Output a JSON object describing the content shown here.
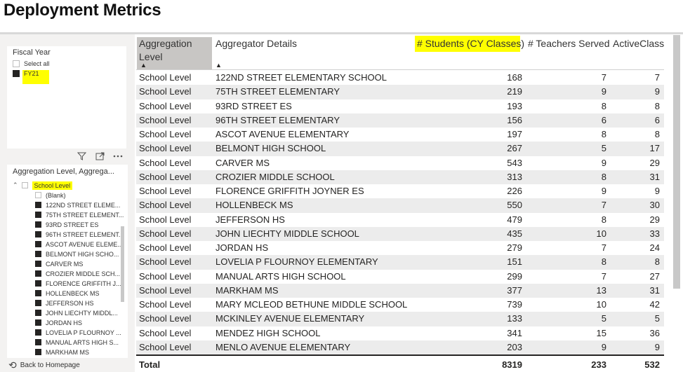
{
  "title": "Deployment Metrics",
  "fiscal_year_slicer": {
    "title": "Fiscal Year",
    "select_all_label": "Select all",
    "selected_year": "FY21"
  },
  "aggregation_slicer": {
    "title": "Aggregation Level, Aggrega...",
    "school_level_label": "School Level",
    "blank_label": "(Blank)",
    "items": [
      "122ND STREET ELEME...",
      "75TH STREET ELEMENT...",
      "93RD STREET ES",
      "96TH STREET ELEMENT...",
      "ASCOT AVENUE ELEME...",
      "BELMONT HIGH SCHO...",
      "CARVER MS",
      "CROZIER MIDDLE SCH...",
      "FLORENCE GRIFFITH J...",
      "HOLLENBECK MS",
      "JEFFERSON HS",
      "JOHN LIECHTY MIDDL...",
      "JORDAN HS",
      "LOVELIA P FLOURNOY ...",
      "MANUAL ARTS HIGH S...",
      "MARKHAM MS"
    ]
  },
  "back_link_label": "Back to Homepage",
  "table": {
    "headers": {
      "aggregation_level_line1": "Aggregation",
      "aggregation_level_line2": "Level",
      "aggregator_details": "Aggregator Details",
      "students": "# Students (CY Classes)",
      "teachers": "# Teachers Served",
      "active_class": "ActiveClass"
    },
    "rows": [
      [
        "School Level",
        "122ND STREET ELEMENTARY SCHOOL",
        "168",
        "7",
        "7"
      ],
      [
        "School Level",
        "75TH STREET ELEMENTARY",
        "219",
        "9",
        "9"
      ],
      [
        "School Level",
        "93RD STREET ES",
        "193",
        "8",
        "8"
      ],
      [
        "School Level",
        "96TH STREET ELEMENTARY",
        "156",
        "6",
        "6"
      ],
      [
        "School Level",
        "ASCOT AVENUE ELEMENTARY",
        "197",
        "8",
        "8"
      ],
      [
        "School Level",
        "BELMONT HIGH SCHOOL",
        "267",
        "5",
        "17"
      ],
      [
        "School Level",
        "CARVER MS",
        "543",
        "9",
        "29"
      ],
      [
        "School Level",
        "CROZIER MIDDLE SCHOOL",
        "313",
        "8",
        "31"
      ],
      [
        "School Level",
        "FLORENCE GRIFFITH JOYNER ES",
        "226",
        "9",
        "9"
      ],
      [
        "School Level",
        "HOLLENBECK MS",
        "550",
        "7",
        "30"
      ],
      [
        "School Level",
        "JEFFERSON HS",
        "479",
        "8",
        "29"
      ],
      [
        "School Level",
        "JOHN LIECHTY MIDDLE SCHOOL",
        "435",
        "10",
        "33"
      ],
      [
        "School Level",
        "JORDAN HS",
        "279",
        "7",
        "24"
      ],
      [
        "School Level",
        "LOVELIA P FLOURNOY ELEMENTARY",
        "151",
        "8",
        "8"
      ],
      [
        "School Level",
        "MANUAL ARTS HIGH SCHOOL",
        "299",
        "7",
        "27"
      ],
      [
        "School Level",
        "MARKHAM MS",
        "377",
        "13",
        "31"
      ],
      [
        "School Level",
        "MARY MCLEOD BETHUNE MIDDLE SCHOOL",
        "739",
        "10",
        "42"
      ],
      [
        "School Level",
        "MCKINLEY AVENUE ELEMENTARY",
        "133",
        "5",
        "5"
      ],
      [
        "School Level",
        "MENDEZ HIGH SCHOOL",
        "341",
        "15",
        "36"
      ],
      [
        "School Level",
        "MENLO AVENUE ELEMENTARY",
        "203",
        "9",
        "9"
      ]
    ],
    "total": {
      "label": "Total",
      "students": "8319",
      "teachers": "233",
      "active_class": "532"
    }
  },
  "colors": {
    "highlight": "#ffff00",
    "sorted_header": "#c8c6c4",
    "alt_row": "#ececec",
    "panel_background": "#f3f2f1"
  }
}
